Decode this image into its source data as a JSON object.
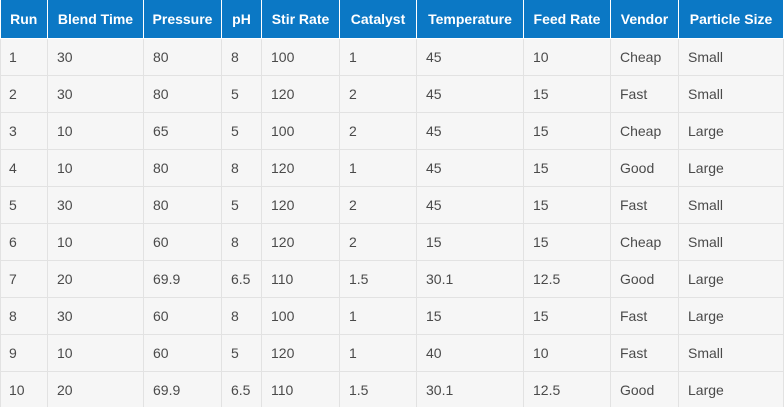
{
  "table": {
    "columns": [
      "Run",
      "Blend Time",
      "Pressure",
      "pH",
      "Stir Rate",
      "Catalyst",
      "Temperature",
      "Feed Rate",
      "Vendor",
      "Particle Size"
    ],
    "rows": [
      [
        "1",
        "30",
        "80",
        "8",
        "100",
        "1",
        "45",
        "10",
        "Cheap",
        "Small"
      ],
      [
        "2",
        "30",
        "80",
        "5",
        "120",
        "2",
        "45",
        "15",
        "Fast",
        "Small"
      ],
      [
        "3",
        "10",
        "65",
        "5",
        "100",
        "2",
        "45",
        "15",
        "Cheap",
        "Large"
      ],
      [
        "4",
        "10",
        "80",
        "8",
        "120",
        "1",
        "45",
        "15",
        "Good",
        "Large"
      ],
      [
        "5",
        "30",
        "80",
        "5",
        "120",
        "2",
        "45",
        "15",
        "Fast",
        "Small"
      ],
      [
        "6",
        "10",
        "60",
        "8",
        "120",
        "2",
        "15",
        "15",
        "Cheap",
        "Small"
      ],
      [
        "7",
        "20",
        "69.9",
        "6.5",
        "110",
        "1.5",
        "30.1",
        "12.5",
        "Good",
        "Large"
      ],
      [
        "8",
        "30",
        "60",
        "8",
        "100",
        "1",
        "15",
        "15",
        "Fast",
        "Large"
      ],
      [
        "9",
        "10",
        "60",
        "5",
        "120",
        "1",
        "40",
        "10",
        "Fast",
        "Small"
      ],
      [
        "10",
        "20",
        "69.9",
        "6.5",
        "110",
        "1.5",
        "30.1",
        "12.5",
        "Good",
        "Large"
      ]
    ]
  },
  "colors": {
    "header_background": "#0b78c5",
    "header_text": "#ffffff",
    "cell_background": "#f6f6f6",
    "cell_text": "#4a4a4a",
    "grid": "#e2e2e2"
  }
}
